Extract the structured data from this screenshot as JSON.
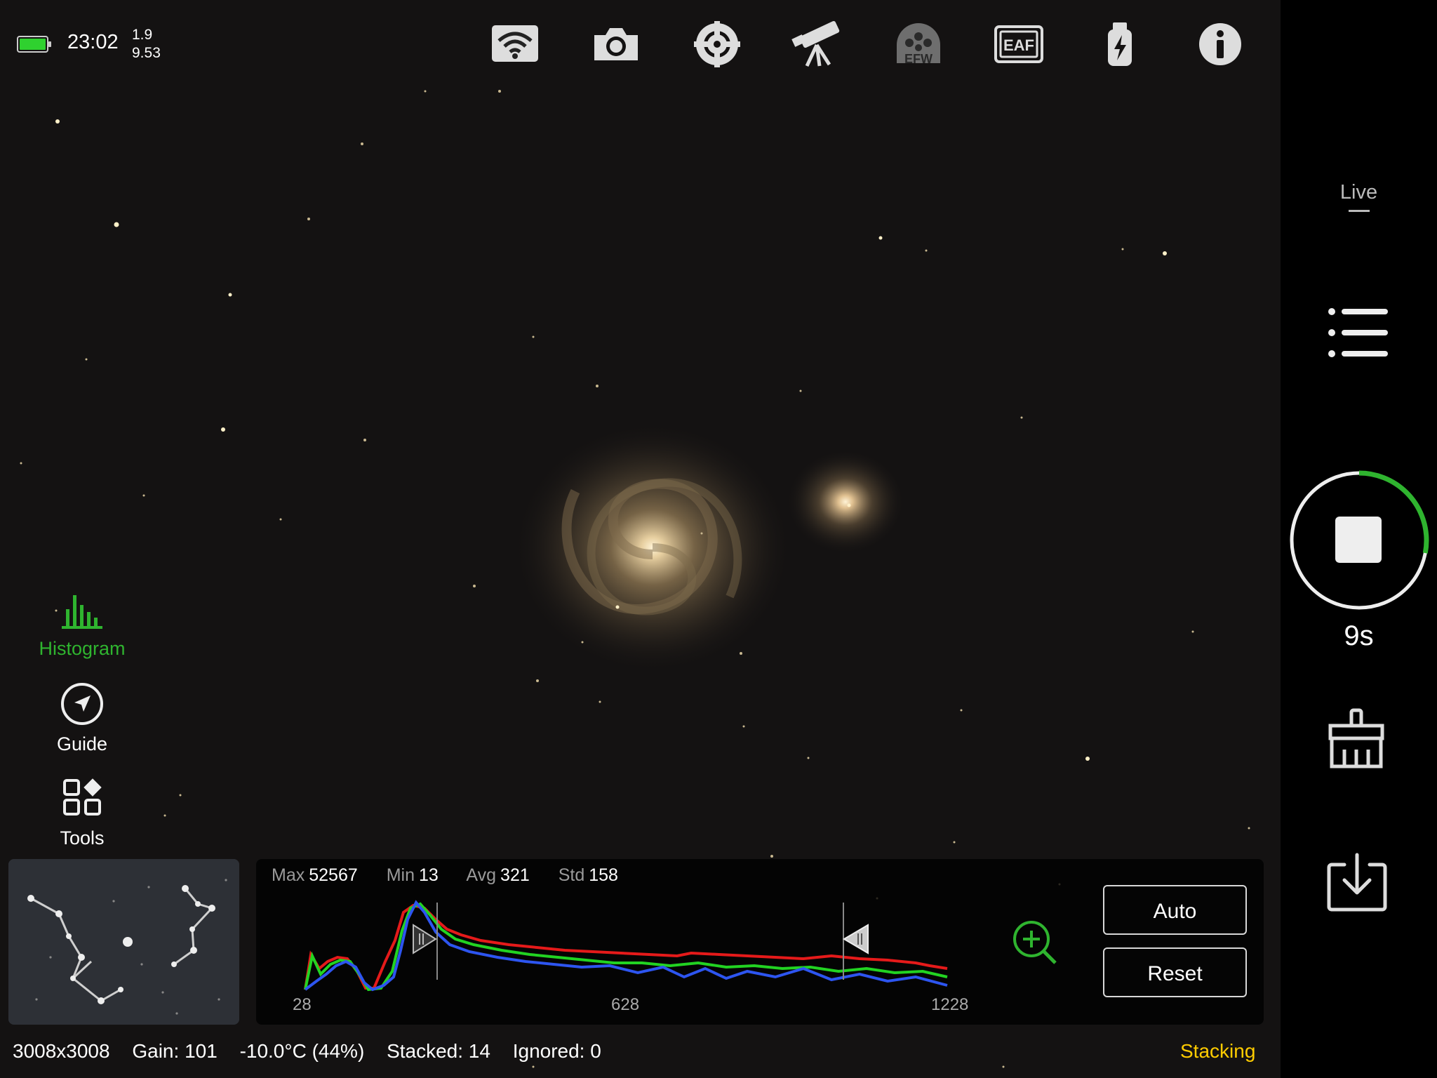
{
  "status": {
    "time": "23:02",
    "line1": "1.9",
    "line2": "9.53",
    "battery_color": "#2fd12f"
  },
  "toolbar": {
    "icons": [
      "wifi-icon",
      "camera-icon",
      "crosshair-icon",
      "telescope-icon",
      "efw-filter-wheel-icon",
      "eaf-focuser-icon",
      "usb-power-icon",
      "info-icon"
    ],
    "efw_label": "EFW",
    "eaf_label": "EAF"
  },
  "left_nav": {
    "histogram": "Histogram",
    "guide": "Guide",
    "tools": "Tools",
    "active_color": "#2fb42f"
  },
  "histogram": {
    "max_label": "Max",
    "max": "52567",
    "min_label": "Min",
    "min": "13",
    "avg_label": "Avg",
    "avg": "321",
    "std_label": "Std",
    "std": "158",
    "axis": [
      "28",
      "628",
      "1228"
    ],
    "auto": "Auto",
    "reset": "Reset"
  },
  "footer": {
    "resolution": "3008x3008",
    "gain": "Gain: 101",
    "temperature": "-10.0°C (44%)",
    "stacked": "Stacked: 14",
    "ignored": "Ignored: 0",
    "state": "Stacking"
  },
  "sidebar": {
    "live": "Live",
    "timer": "9s",
    "progress": 0.28,
    "accent": "#2fb42f"
  }
}
